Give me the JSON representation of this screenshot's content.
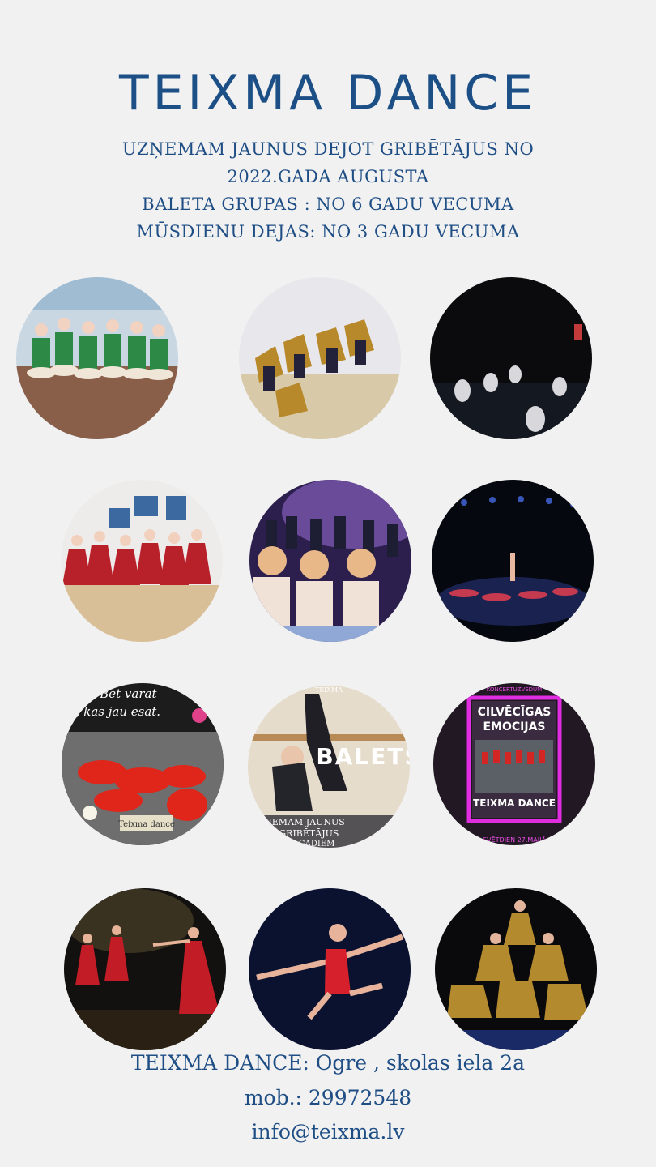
{
  "title": "TEIXMA DANCE",
  "intro_lines": [
    "UZŅEMAM JAUNUS DEJOT GRIBĒTĀJUS NO",
    "2022.GADA AUGUSTA",
    "BALETA GRUPAS : NO 6 GADU VECUMA",
    "MŪSDIENU DEJAS: NO 3 GADU VECUMA"
  ],
  "photos": [
    {
      "name": "photo-ballet-green-costumes"
    },
    {
      "name": "photo-mustard-costumes-group"
    },
    {
      "name": "photo-dark-stage-floor-pose"
    },
    {
      "name": "photo-red-dresses-gallery"
    },
    {
      "name": "photo-kids-stage-smoke"
    },
    {
      "name": "photo-blue-lit-stage"
    },
    {
      "name": "photo-poster-red-dancers",
      "texts": [
        "s. Bet varat",
        "s, kas jau esat.",
        "Teixma dance"
      ]
    },
    {
      "name": "photo-poster-balets",
      "texts": [
        "BALETS",
        "TEIXMA",
        "NEMAM JAUNUS",
        "T GRIBĒTĀJUS",
        "GADIEM"
      ]
    },
    {
      "name": "photo-poster-emocijas",
      "texts": [
        "KONCERTUZVEDUM",
        "CILVĒCĪGAS",
        "EMOCIJAS",
        "TEIXMA DANCE",
        "SVĒTDIEN 27.MAIJĀ"
      ]
    },
    {
      "name": "photo-red-ballet-line"
    },
    {
      "name": "photo-leap-red-leotard"
    },
    {
      "name": "photo-mustard-pyramid"
    }
  ],
  "footer": {
    "address": "TEIXMA DANCE: Ogre , skolas iela 2a",
    "phone": "mob.: 29972548",
    "email": "info@teixma.lv"
  }
}
